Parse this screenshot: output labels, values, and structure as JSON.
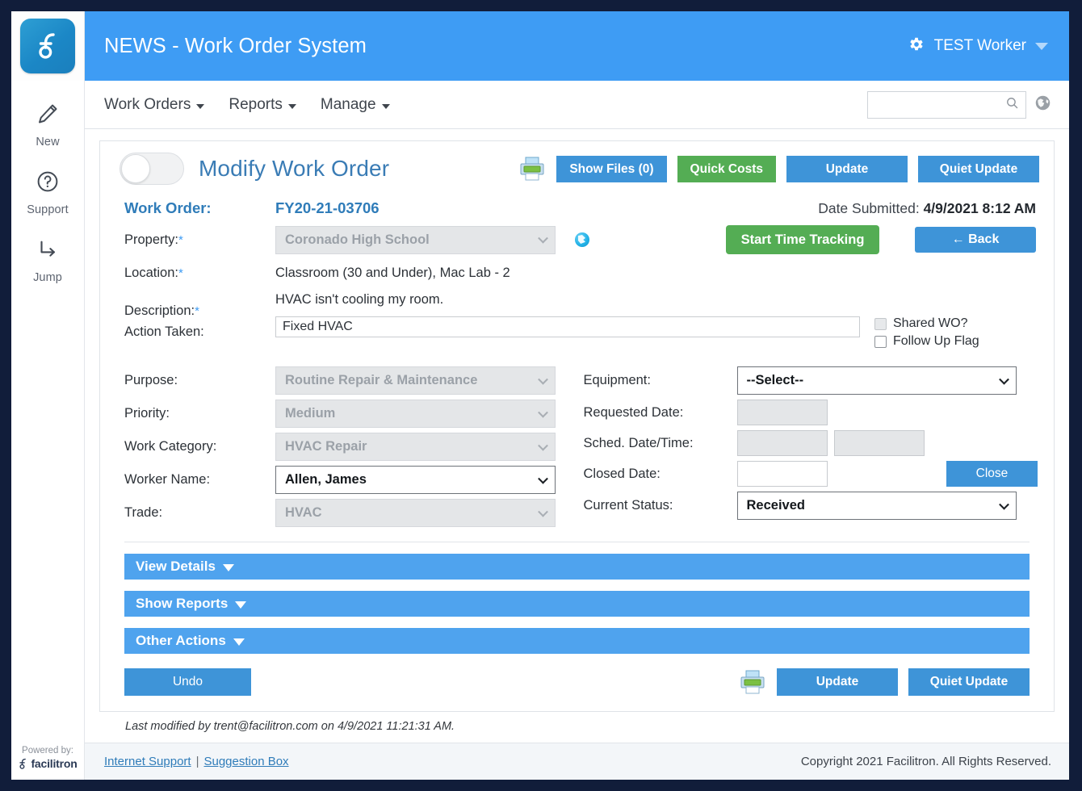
{
  "sidebar": {
    "logo_icon": "facilitron-logo-icon",
    "items": [
      {
        "label": "New",
        "icon": "pencil-icon"
      },
      {
        "label": "Support",
        "icon": "question-circle-icon"
      },
      {
        "label": "Jump",
        "icon": "arrow-turn-down-right-icon"
      }
    ],
    "powered_by": "Powered by:",
    "brand": "facilitron"
  },
  "topbar": {
    "title": "NEWS - Work Order System",
    "gear_icon": "gear-icon",
    "user": "TEST Worker",
    "caret_icon": "chevron-down-icon"
  },
  "nav": {
    "items": [
      {
        "label": "Work Orders"
      },
      {
        "label": "Reports"
      },
      {
        "label": "Manage"
      }
    ],
    "search_value": "",
    "search_placeholder": "",
    "search_icon": "search-icon",
    "globe_icon": "globe-icon"
  },
  "card": {
    "toggle_state": "off",
    "title": "Modify Work Order",
    "print_icon": "printer-icon",
    "buttons": {
      "show_files": "Show Files (0)",
      "quick_costs": "Quick Costs",
      "update": "Update",
      "quiet_update": "Quiet Update"
    },
    "work_order_label": "Work Order:",
    "work_order_value": "FY20-21-03706",
    "date_submitted_label": "Date Submitted:",
    "date_submitted_value": "4/9/2021 8:12 AM",
    "start_time_tracking": "Start Time Tracking",
    "back": "← Back",
    "fields": {
      "property_label": "Property:",
      "property_value": "Coronado High School",
      "property_globe_icon": "globe-icon",
      "location_label": "Location:",
      "location_value": "Classroom (30 and Under), Mac Lab - 2",
      "description_label": "Description:",
      "description_value": "HVAC isn't cooling my room.",
      "action_taken_label": "Action Taken:",
      "action_taken_value": "Fixed HVAC",
      "action_taken_placeholder": "",
      "shared_wo_label": "Shared WO?",
      "shared_wo_checked": false,
      "follow_up_label": "Follow Up Flag",
      "follow_up_checked": false,
      "purpose_label": "Purpose:",
      "purpose_value": "Routine Repair & Maintenance",
      "priority_label": "Priority:",
      "priority_value": "Medium",
      "work_category_label": "Work Category:",
      "work_category_value": "HVAC Repair",
      "worker_name_label": "Worker Name:",
      "worker_name_value": "Allen, James",
      "trade_label": "Trade:",
      "trade_value": "HVAC",
      "equipment_label": "Equipment:",
      "equipment_value": "--Select--",
      "requested_date_label": "Requested Date:",
      "requested_date_value": "",
      "sched_date_label": "Sched. Date/Time:",
      "sched_date_value": "",
      "sched_time_value": "",
      "closed_date_label": "Closed Date:",
      "closed_date_value": "",
      "close_button": "Close",
      "current_status_label": "Current Status:",
      "current_status_value": "Received"
    },
    "accordions": [
      {
        "label": "View Details"
      },
      {
        "label": "Show Reports"
      },
      {
        "label": "Other Actions"
      }
    ],
    "bottom": {
      "undo": "Undo",
      "print_icon": "printer-icon",
      "update": "Update",
      "quiet_update": "Quiet Update"
    },
    "last_modified": "Last modified by trent@facilitron.com on 4/9/2021 11:21:31 AM."
  },
  "footer": {
    "internet_support": "Internet Support",
    "separator": "|",
    "suggestion_box": "Suggestion Box",
    "copyright": "Copyright 2021 Facilitron. All Rights Reserved."
  },
  "colors": {
    "brand_blue": "#3e9cf4",
    "accent_blue": "#3e94d8",
    "accent_green": "#54ad54",
    "title_blue": "#3a7cb5",
    "page_border": "#111d3a"
  }
}
